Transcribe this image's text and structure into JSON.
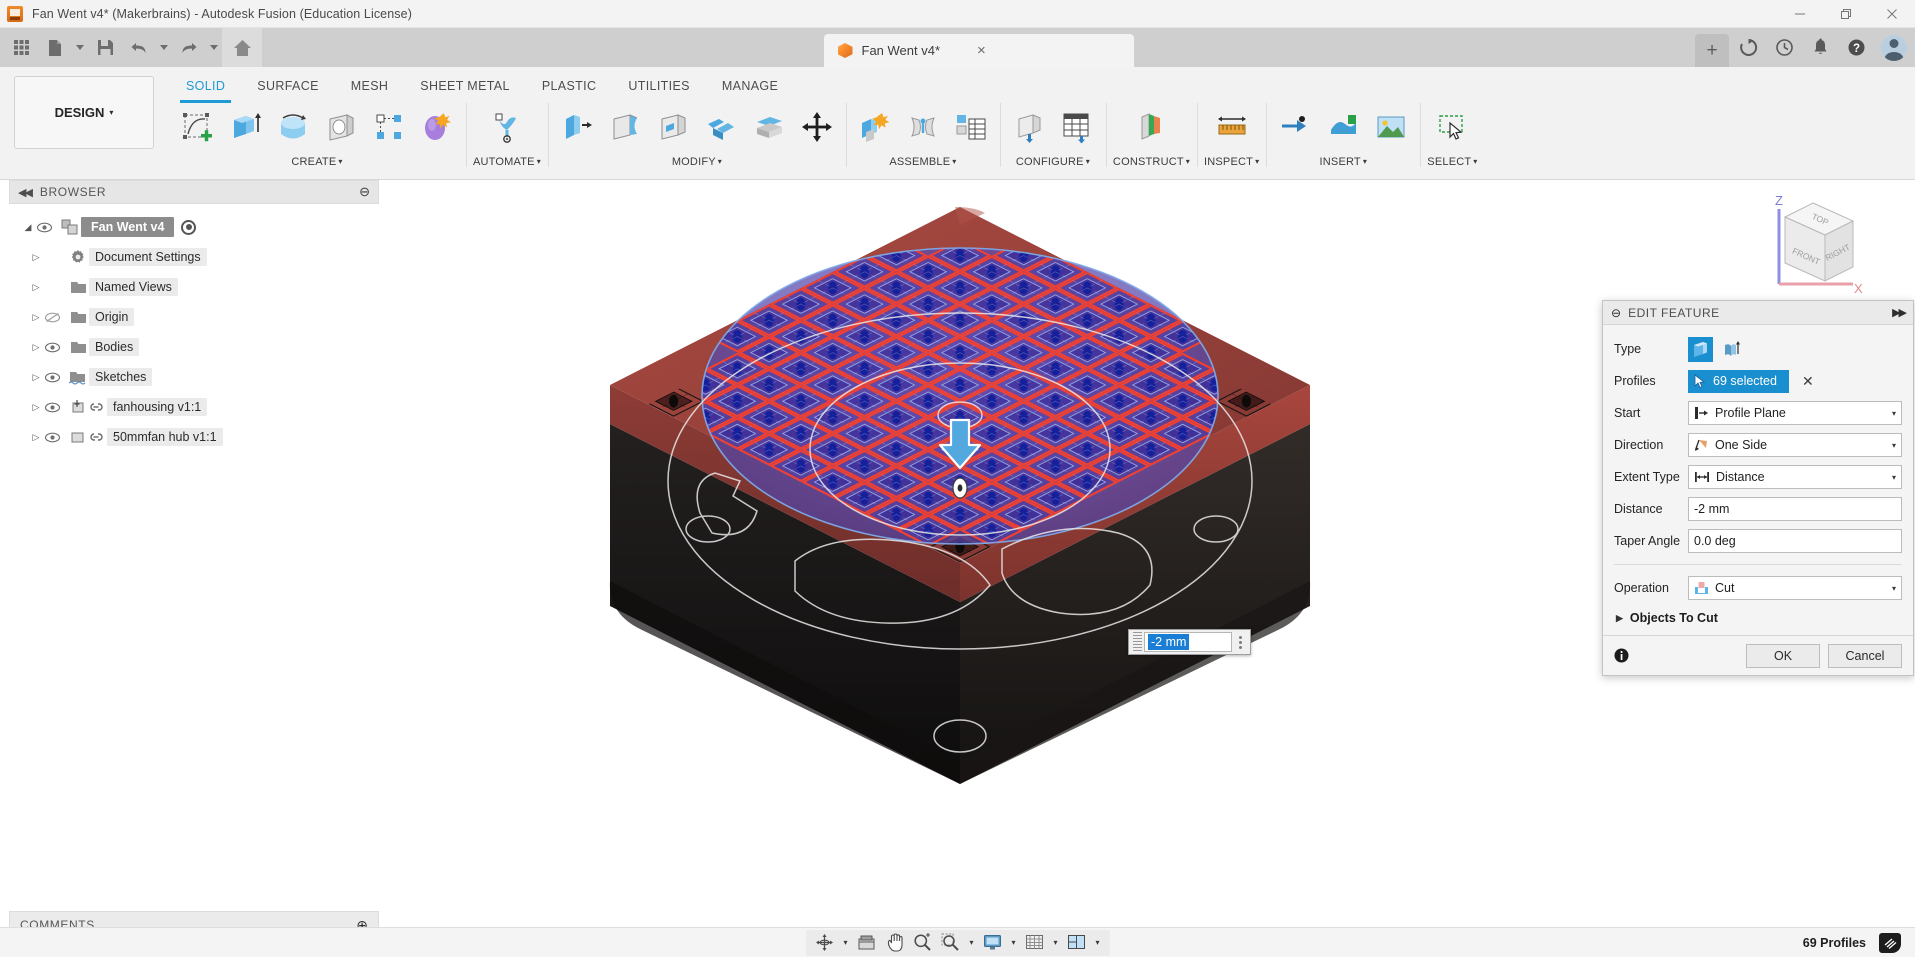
{
  "window": {
    "title": "Fan Went v4* (Makerbrains) - Autodesk Fusion (Education License)",
    "minimize_label": "Minimize",
    "restore_label": "Restore",
    "close_label": "Close"
  },
  "quick_access": {
    "grid_label": "App Grid",
    "new_label": "New",
    "save_label": "Save",
    "undo_label": "Undo",
    "redo_label": "Redo",
    "home_label": "Home",
    "new_tab_label": "+",
    "doc_tab": {
      "title": "Fan Went v4*",
      "close_label": "×"
    },
    "right_icons": [
      "refresh-icon",
      "recent-icon",
      "notifications-icon",
      "help-icon"
    ]
  },
  "ribbon": {
    "workspace": {
      "label": "DESIGN",
      "caret": "▾"
    },
    "tabs": [
      {
        "label": "SOLID",
        "active": true
      },
      {
        "label": "SURFACE",
        "active": false
      },
      {
        "label": "MESH",
        "active": false
      },
      {
        "label": "SHEET METAL",
        "active": false
      },
      {
        "label": "PLASTIC",
        "active": false
      },
      {
        "label": "UTILITIES",
        "active": false
      },
      {
        "label": "MANAGE",
        "active": false
      }
    ],
    "groups": [
      {
        "label": "CREATE",
        "caret": "▾",
        "buttons": [
          "create-sketch-icon",
          "extrude-icon",
          "revolve-icon",
          "hole-icon",
          "pattern-icon",
          "form-icon"
        ]
      },
      {
        "label": "AUTOMATE",
        "caret": "▾",
        "buttons": [
          "automate-icon"
        ]
      },
      {
        "label": "MODIFY",
        "caret": "▾",
        "buttons": [
          "press-pull-icon",
          "fillet-icon",
          "shell-icon",
          "draft-icon",
          "split-face-icon",
          "move-copy-icon"
        ]
      },
      {
        "label": "ASSEMBLE",
        "caret": "▾",
        "buttons": [
          "new-component-icon",
          "joint-icon",
          "bom-icon"
        ]
      },
      {
        "label": "CONFIGURE",
        "caret": "▾",
        "buttons": [
          "configure-icon",
          "configure-table-icon"
        ]
      },
      {
        "label": "CONSTRUCT",
        "caret": "▾",
        "buttons": [
          "offset-plane-icon"
        ]
      },
      {
        "label": "INSPECT",
        "caret": "▾",
        "buttons": [
          "measure-icon"
        ]
      },
      {
        "label": "INSERT",
        "caret": "▾",
        "buttons": [
          "insert-derive-icon",
          "insert-mesh-icon",
          "insert-canvas-icon"
        ]
      },
      {
        "label": "SELECT",
        "caret": "▾",
        "buttons": [
          "select-window-icon"
        ]
      }
    ]
  },
  "browser": {
    "title": "BROWSER",
    "collapse_label": "◀◀",
    "minimize_label": "⊖",
    "root": {
      "label": "Fan Went v4",
      "twist": "◢",
      "visible": true
    },
    "items": [
      {
        "label": "Document Settings",
        "icon": "gear-icon",
        "twist": "▷",
        "has_eye": false,
        "eye_on": false,
        "has_link": false
      },
      {
        "label": "Named Views",
        "icon": "folder-icon",
        "twist": "▷",
        "has_eye": false,
        "eye_on": false,
        "has_link": false
      },
      {
        "label": "Origin",
        "icon": "folder-icon",
        "twist": "▷",
        "has_eye": true,
        "eye_on": false,
        "has_link": false
      },
      {
        "label": "Bodies",
        "icon": "folder-icon",
        "twist": "▷",
        "has_eye": true,
        "eye_on": true,
        "has_link": false
      },
      {
        "label": "Sketches",
        "icon": "sketch-folder-icon",
        "twist": "▷",
        "has_eye": true,
        "eye_on": true,
        "has_link": false
      },
      {
        "label": "fanhousing v1:1",
        "icon": "component-anchor-icon",
        "twist": "▷",
        "has_eye": true,
        "eye_on": true,
        "has_link": true
      },
      {
        "label": "50mmfan hub v1:1",
        "icon": "component-icon",
        "twist": "▷",
        "has_eye": true,
        "eye_on": true,
        "has_link": true
      }
    ]
  },
  "comments": {
    "title": "COMMENTS",
    "add_label": "⊕"
  },
  "canvas": {
    "dimension_input": {
      "value": "-2 mm",
      "menu_label": "⋮"
    },
    "viewcube": {
      "top_label": "TOP",
      "front_label": "FRONT",
      "right_label": "RIGHT",
      "z_axis_label": "Z",
      "x_axis_label": "X"
    }
  },
  "edit_feature": {
    "title": "EDIT FEATURE",
    "expand_label": "▶▶",
    "rows": {
      "type": {
        "label": "Type",
        "options": [
          "profile-extrude-icon",
          "surface-extrude-icon"
        ],
        "selected_index": 0
      },
      "profiles": {
        "label": "Profiles",
        "value": "69 selected",
        "clear_label": "✕",
        "cursor_icon": "arrow-cursor-icon"
      },
      "start": {
        "label": "Start",
        "value": "Profile Plane",
        "icon": "profile-plane-icon",
        "caret": "▾"
      },
      "direction": {
        "label": "Direction",
        "value": "One Side",
        "icon": "one-side-icon",
        "caret": "▾"
      },
      "extent_type": {
        "label": "Extent Type",
        "value": "Distance",
        "icon": "distance-icon",
        "caret": "▾"
      },
      "distance": {
        "label": "Distance",
        "value": "-2 mm"
      },
      "taper_angle": {
        "label": "Taper Angle",
        "value": "0.0 deg"
      },
      "operation": {
        "label": "Operation",
        "value": "Cut",
        "icon": "cut-icon",
        "caret": "▾"
      }
    },
    "objects_to_cut": {
      "label": "Objects To Cut",
      "twist": "▶"
    },
    "footer": {
      "info_label": "ⓘ",
      "ok_label": "OK",
      "cancel_label": "Cancel"
    }
  },
  "status_bar": {
    "nav_buttons": [
      {
        "name": "orbit-icon",
        "caret": true
      },
      {
        "name": "look-at-icon",
        "caret": false
      },
      {
        "name": "pan-icon",
        "caret": false
      },
      {
        "name": "zoom-icon",
        "caret": false
      },
      {
        "name": "zoom-window-icon",
        "caret": true
      },
      {
        "name": "display-settings-icon",
        "caret": true
      },
      {
        "name": "grid-snap-icon",
        "caret": true
      },
      {
        "name": "viewports-icon",
        "caret": true
      }
    ],
    "selection_count": "69 Profiles",
    "badge_label": "≡"
  },
  "colors": {
    "accent": "#1e9ad6",
    "selection_blue": "#1a8fd0",
    "housing_red": "#9e4038",
    "housing_black": "#1a1715",
    "highlight_purple": "#6a5bb5",
    "profile_red": "#e03020"
  }
}
